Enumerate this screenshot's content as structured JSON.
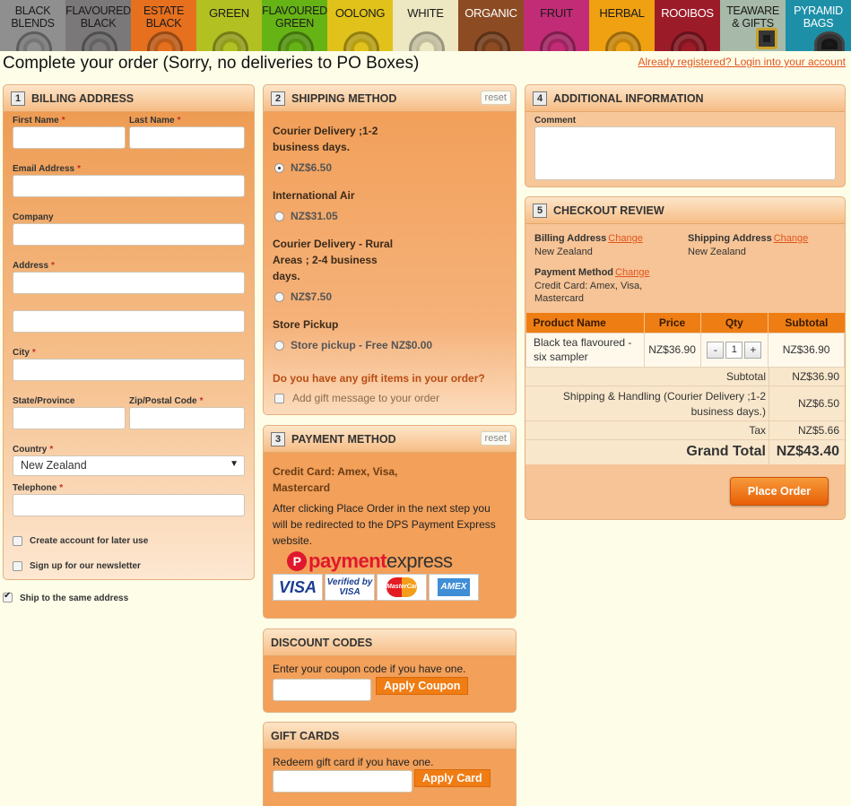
{
  "nav": {
    "tabs": [
      {
        "label": "BLACK BLENDS",
        "color": "#8f8f8f"
      },
      {
        "label": "FLAVOURED BLACK",
        "color": "#7a7878"
      },
      {
        "label": "ESTATE BLACK",
        "color": "#e6701e"
      },
      {
        "label": "GREEN",
        "color": "#b2c022"
      },
      {
        "label": "FLAVOURED GREEN",
        "color": "#66b315"
      },
      {
        "label": "OOLONG",
        "color": "#e0c21a"
      },
      {
        "label": "WHITE",
        "color": "#ede7c2"
      },
      {
        "label": "ORGANIC",
        "color": "#8c4b23"
      },
      {
        "label": "FRUIT",
        "color": "#c22c77"
      },
      {
        "label": "HERBAL",
        "color": "#efa111"
      },
      {
        "label": "ROOIBOS",
        "color": "#9c1b28"
      },
      {
        "label": "TEAWARE & GIFTS",
        "color": "#a7b9a8"
      },
      {
        "label": "PYRAMID BAGS",
        "color": "#1d90a8"
      }
    ]
  },
  "header": {
    "title": "Complete your order (Sorry, no deliveries to PO Boxes)",
    "login_link": "Already registered? Login into your account"
  },
  "billing": {
    "step": "1",
    "title": "BILLING ADDRESS",
    "first_name_label": "First Name",
    "last_name_label": "Last Name",
    "email_label": "Email Address",
    "company_label": "Company",
    "address_label": "Address",
    "city_label": "City",
    "state_label": "State/Province",
    "zip_label": "Zip/Postal Code",
    "country_label": "Country",
    "country_value": "New Zealand",
    "telephone_label": "Telephone",
    "create_account_label": "Create account for later use",
    "newsletter_label": "Sign up for our newsletter",
    "same_address_label": "Ship to the same address",
    "required_mark": "*"
  },
  "shipping": {
    "step": "2",
    "title": "SHIPPING METHOD",
    "reset": "reset",
    "methods": [
      {
        "title_lines": [
          "Courier Delivery ;1-2",
          "business days."
        ],
        "option": "NZ$6.50"
      },
      {
        "title_lines": [
          "International Air"
        ],
        "option": "NZ$31.05"
      },
      {
        "title_lines": [
          "Courier Delivery - Rural",
          "Areas ; 2-4 business",
          "days."
        ],
        "option": "NZ$7.50"
      },
      {
        "title_lines": [
          "Store Pickup"
        ],
        "option": "Store pickup - Free NZ$0.00"
      }
    ],
    "gift_question": "Do you have any gift items in your order?",
    "gift_label": "Add gift message to your order"
  },
  "payment": {
    "step": "3",
    "title": "PAYMENT METHOD",
    "reset": "reset",
    "method_lines": [
      "Credit Card: Amex, Visa,",
      "Mastercard"
    ],
    "note_lines": [
      "After clicking Place Order in the next step you",
      "will be redirected to the DPS Payment Express",
      "website."
    ],
    "logo_a": "payment",
    "logo_b": "express",
    "cards": [
      "VISA",
      "Verified by VISA",
      "MasterCard",
      "AMEX"
    ]
  },
  "discount": {
    "title": "DISCOUNT CODES",
    "text": "Enter your coupon code if you have one.",
    "button": "Apply Coupon"
  },
  "giftcards": {
    "title": "GIFT CARDS",
    "text": "Redeem gift card if you have one.",
    "button": "Apply Card"
  },
  "additional": {
    "step": "4",
    "title": "ADDITIONAL INFORMATION",
    "comment_label": "Comment"
  },
  "review": {
    "step": "5",
    "title": "CHECKOUT REVIEW",
    "change": "Change",
    "billing_label": "Billing Address",
    "billing_value": "New Zealand",
    "shipping_label": "Shipping Address",
    "shipping_value": "New Zealand",
    "payment_label": "Payment Method",
    "payment_value_lines": [
      "Credit Card: Amex, Visa,",
      "Mastercard"
    ],
    "columns": [
      "Product Name",
      "Price",
      "Qty",
      "Subtotal"
    ],
    "item": {
      "name_lines": [
        "Black tea flavoured -",
        "six sampler"
      ],
      "price": "NZ$36.90",
      "qty": "1",
      "subtotal": "NZ$36.90"
    },
    "qty_minus": "-",
    "qty_plus": "+",
    "subtotal_label": "Subtotal",
    "subtotal_value": "NZ$36.90",
    "shipping_handling_lines": [
      "Shipping & Handling (Courier Delivery ;1-2",
      "business days.)"
    ],
    "shipping_handling_value": "NZ$6.50",
    "tax_label": "Tax",
    "tax_value": "NZ$5.66",
    "grand_total_label": "Grand Total",
    "grand_total_value": "NZ$43.40",
    "place_order": "Place Order"
  }
}
